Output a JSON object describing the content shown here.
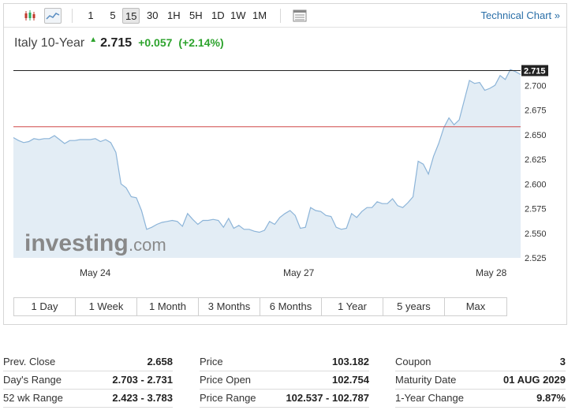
{
  "toolbar": {
    "intervals": [
      {
        "label": "1",
        "active": false
      },
      {
        "label": "5",
        "active": false
      },
      {
        "label": "15",
        "active": true
      },
      {
        "label": "30",
        "active": false
      },
      {
        "label": "1H",
        "active": false
      },
      {
        "label": "5H",
        "active": false
      },
      {
        "label": "1D",
        "active": false
      },
      {
        "label": "1W",
        "active": false
      },
      {
        "label": "1M",
        "active": false
      }
    ],
    "technical_chart_label": "Technical Chart »"
  },
  "instrument": {
    "name": "Italy 10-Year",
    "price": "2.715",
    "change": "+0.057",
    "change_pct": "(+2.14%)",
    "direction_icon": "up-arrow-icon"
  },
  "chart_data": {
    "type": "area",
    "y_ticks": [
      "2.700",
      "2.675",
      "2.650",
      "2.625",
      "2.600",
      "2.575",
      "2.550",
      "2.525"
    ],
    "x_labels": [
      "May 24",
      "May 27",
      "May 28"
    ],
    "ylim": [
      2.525,
      2.715
    ],
    "current_price_label": "2.715",
    "current_price": 2.715,
    "prev_close": 2.658,
    "watermark": "investing.com",
    "series_color": "#8cb4d8",
    "fill_color": "#e3edf5",
    "prev_close_line_color": "#d04848",
    "values": [
      2.647,
      2.644,
      2.642,
      2.643,
      2.646,
      2.645,
      2.646,
      2.646,
      2.649,
      2.645,
      2.641,
      2.644,
      2.644,
      2.645,
      2.645,
      2.645,
      2.646,
      2.643,
      2.645,
      2.642,
      2.632,
      2.6,
      2.596,
      2.587,
      2.586,
      2.573,
      2.554,
      2.556,
      2.559,
      2.561,
      2.562,
      2.563,
      2.562,
      2.557,
      2.57,
      2.564,
      2.559,
      2.563,
      2.563,
      2.564,
      2.563,
      2.556,
      2.565,
      2.555,
      2.558,
      2.554,
      2.554,
      2.552,
      2.551,
      2.553,
      2.562,
      2.559,
      2.566,
      2.57,
      2.573,
      2.568,
      2.555,
      2.556,
      2.576,
      2.573,
      2.572,
      2.568,
      2.567,
      2.556,
      2.554,
      2.555,
      2.57,
      2.566,
      2.572,
      2.576,
      2.576,
      2.582,
      2.58,
      2.58,
      2.585,
      2.578,
      2.576,
      2.581,
      2.587,
      2.623,
      2.62,
      2.61,
      2.628,
      2.641,
      2.657,
      2.667,
      2.66,
      2.665,
      2.685,
      2.705,
      2.702,
      2.703,
      2.695,
      2.697,
      2.7,
      2.71,
      2.706,
      2.716,
      2.714,
      2.711
    ]
  },
  "range_buttons": [
    "1 Day",
    "1 Week",
    "1 Month",
    "3 Months",
    "6 Months",
    "1 Year",
    "5 years",
    "Max"
  ],
  "stats": {
    "col1": [
      {
        "label": "Prev. Close",
        "value": "2.658"
      },
      {
        "label": "Day's Range",
        "value": "2.703 - 2.731"
      },
      {
        "label": "52 wk Range",
        "value": "2.423 - 3.783"
      }
    ],
    "col2": [
      {
        "label": "Price",
        "value": "103.182"
      },
      {
        "label": "Price Open",
        "value": "102.754"
      },
      {
        "label": "Price Range",
        "value": "102.537 - 102.787"
      }
    ],
    "col3": [
      {
        "label": "Coupon",
        "value": "3"
      },
      {
        "label": "Maturity Date",
        "value": "01 AUG 2029"
      },
      {
        "label": "1-Year Change",
        "value": "9.87%"
      }
    ]
  }
}
